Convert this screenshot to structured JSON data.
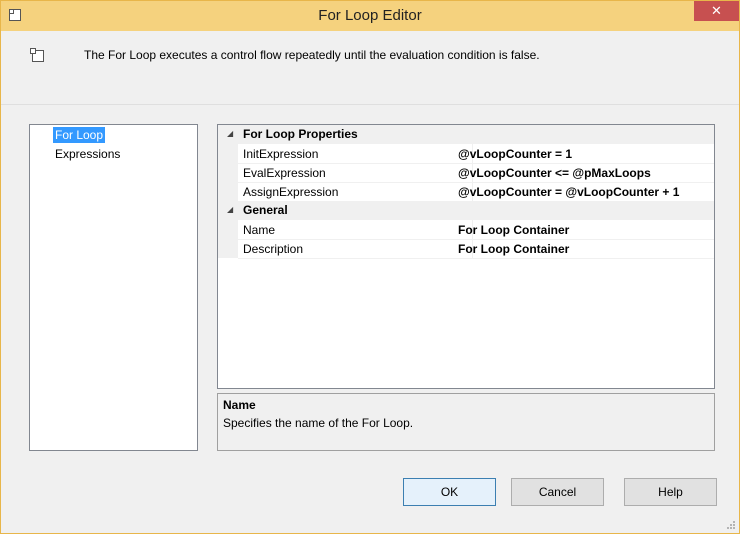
{
  "window": {
    "title": "For Loop Editor",
    "close_glyph": "✕",
    "title_icon": "for-loop-icon",
    "accent_color": "#f5d27e",
    "close_color": "#c75050"
  },
  "header": {
    "icon": "for-loop-icon",
    "description": "The For Loop executes a control flow repeatedly until the evaluation condition is false."
  },
  "nav": {
    "items": [
      {
        "label": "For Loop",
        "selected": true
      },
      {
        "label": "Expressions",
        "selected": false
      }
    ],
    "selected_color": "#3399ff"
  },
  "grid": {
    "categories": [
      {
        "label": "For Loop Properties",
        "properties": [
          {
            "name": "InitExpression",
            "value": "@vLoopCounter = 1"
          },
          {
            "name": "EvalExpression",
            "value": "@vLoopCounter <= @pMaxLoops"
          },
          {
            "name": "AssignExpression",
            "value": "@vLoopCounter = @vLoopCounter + 1"
          }
        ]
      },
      {
        "label": "General",
        "properties": [
          {
            "name": "Name",
            "value": "For Loop Container"
          },
          {
            "name": "Description",
            "value": "For Loop Container"
          }
        ]
      }
    ],
    "collapse_glyph": "◢"
  },
  "help": {
    "title": "Name",
    "description": "Specifies the name of the For Loop."
  },
  "buttons": {
    "ok": "OK",
    "cancel": "Cancel",
    "help": "Help"
  }
}
